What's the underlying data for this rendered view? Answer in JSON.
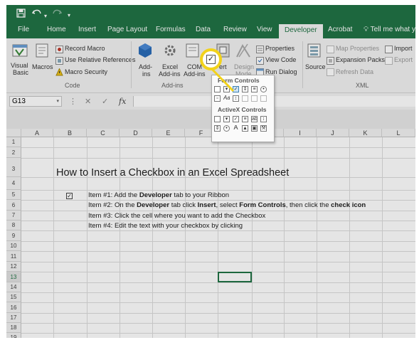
{
  "qat": {
    "save_icon": "save-icon",
    "undo_icon": "undo-icon",
    "redo_icon": "redo-icon"
  },
  "tabs": [
    "File",
    "Home",
    "Insert",
    "Page Layout",
    "Formulas",
    "Data",
    "Review",
    "View",
    "Developer",
    "Acrobat"
  ],
  "tell_me": "Tell me what yo",
  "ribbon": {
    "visual_basic_1": "Visual",
    "visual_basic_2": "Basic",
    "macros": "Macros",
    "record_macro": "Record Macro",
    "relative_refs": "Use Relative References",
    "macro_security": "Macro Security",
    "group_code": "Code",
    "addins_1": "Add-",
    "addins_2": "ins",
    "excel_addins_1": "Excel",
    "excel_addins_2": "Add-ins",
    "com_addins_1": "COM",
    "com_addins_2": "Add-ins",
    "group_addins": "Add-ins",
    "insert_partial": "ert",
    "design_mode_1": "Design",
    "design_mode_2": "Mode",
    "properties": "Properties",
    "view_code": "View Code",
    "run_dialog": "Run Dialog",
    "source": "Source",
    "map_properties": "Map Properties",
    "expansion_packs": "Expansion Packs",
    "refresh_data": "Refresh Data",
    "import": "Import",
    "export": "Export",
    "group_xml": "XML"
  },
  "formula_bar": {
    "name_box": "G13",
    "cancel": "✕",
    "enter": "✓",
    "fx": "fx"
  },
  "dropdown": {
    "form_controls": "Form Controls",
    "activex_controls": "ActiveX Controls"
  },
  "columns": [
    "A",
    "B",
    "C",
    "D",
    "E",
    "F",
    "G",
    "H",
    "I",
    "J",
    "K",
    "L"
  ],
  "rows": [
    "1",
    "2",
    "3",
    "4",
    "5",
    "6",
    "7",
    "8",
    "9",
    "10",
    "11",
    "12",
    "13",
    "14",
    "15",
    "16",
    "17",
    "18",
    "19"
  ],
  "sheet": {
    "title": "How to Insert a Checkbox in an Excel Spreadsheet",
    "checkbox_checked": true,
    "item1_pre": "Item #1: Add the ",
    "item1_bold": "Developer",
    "item1_post": " tab to your Ribbon",
    "item2_a": "Item #2: On the ",
    "item2_b": "Developer",
    "item2_c": " tab click ",
    "item2_d": "Insert",
    "item2_e": ", select ",
    "item2_f": "Form Controls",
    "item2_g": ", then click the ",
    "item2_h": "check icon",
    "item3": "Item #3: Click the cell where you want to add the Checkbox",
    "item4": "Item #4: Edit the text with your checkbox by clicking"
  },
  "colors": {
    "excel_green": "#217346",
    "callout_yellow": "#f2d21b",
    "addin_blue": "#2b6cb8"
  }
}
